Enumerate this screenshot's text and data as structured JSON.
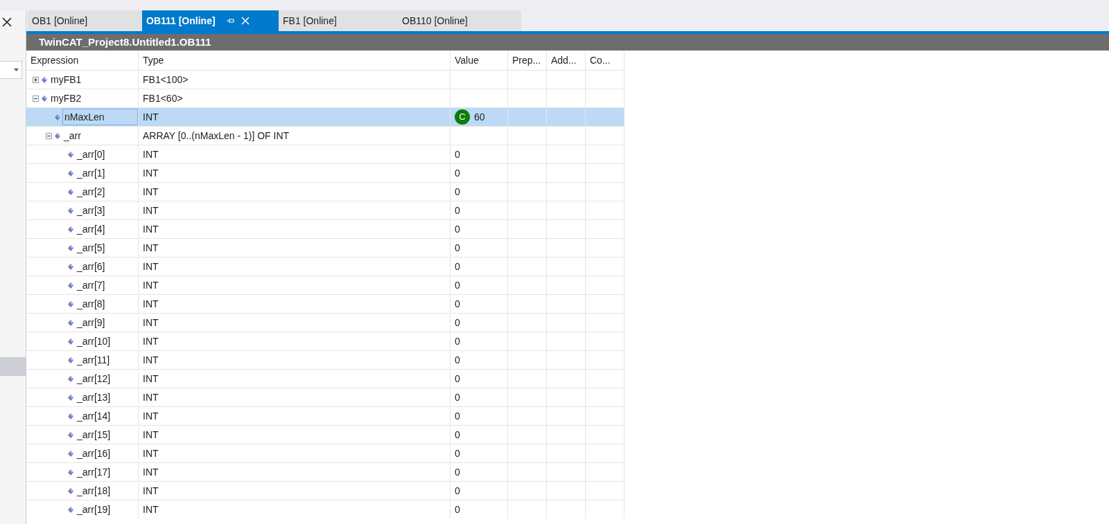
{
  "tabs": [
    {
      "label": "OB1 [Online]",
      "selected": false
    },
    {
      "label": "OB111 [Online]",
      "selected": true
    },
    {
      "label": "FB1 [Online]",
      "selected": false
    },
    {
      "label": "OB110 [Online]",
      "selected": false
    }
  ],
  "editor": {
    "title": "TwinCAT_Project8.Untitled1.OB111"
  },
  "table": {
    "columns": [
      "Expression",
      "Type",
      "Value",
      "Prep...",
      "Add...",
      "Co..."
    ],
    "rows": [
      {
        "expression": "myFB1",
        "type": "FB1<100>",
        "expanded": false,
        "selected": false
      },
      {
        "expression": "myFB2",
        "type": "FB1<60>",
        "expanded": true,
        "selected": false,
        "children": [
          {
            "expression": "nMaxLen",
            "type": "INT",
            "value": "60",
            "badge": "C",
            "selected": true
          },
          {
            "expression": "_arr",
            "type": "ARRAY [0..(nMaxLen - 1)] OF INT",
            "expanded": true,
            "selected": false,
            "children": [
              {
                "expression": "_arr[0]",
                "type": "INT",
                "value": "0",
                "selected": false
              },
              {
                "expression": "_arr[1]",
                "type": "INT",
                "value": "0",
                "selected": false
              },
              {
                "expression": "_arr[2]",
                "type": "INT",
                "value": "0",
                "selected": false
              },
              {
                "expression": "_arr[3]",
                "type": "INT",
                "value": "0",
                "selected": false
              },
              {
                "expression": "_arr[4]",
                "type": "INT",
                "value": "0",
                "selected": false
              },
              {
                "expression": "_arr[5]",
                "type": "INT",
                "value": "0",
                "selected": false
              },
              {
                "expression": "_arr[6]",
                "type": "INT",
                "value": "0",
                "selected": false
              },
              {
                "expression": "_arr[7]",
                "type": "INT",
                "value": "0",
                "selected": false
              },
              {
                "expression": "_arr[8]",
                "type": "INT",
                "value": "0",
                "selected": false
              },
              {
                "expression": "_arr[9]",
                "type": "INT",
                "value": "0",
                "selected": false
              },
              {
                "expression": "_arr[10]",
                "type": "INT",
                "value": "0",
                "selected": false
              },
              {
                "expression": "_arr[11]",
                "type": "INT",
                "value": "0",
                "selected": false
              },
              {
                "expression": "_arr[12]",
                "type": "INT",
                "value": "0",
                "selected": false
              },
              {
                "expression": "_arr[13]",
                "type": "INT",
                "value": "0",
                "selected": false
              },
              {
                "expression": "_arr[14]",
                "type": "INT",
                "value": "0",
                "selected": false
              },
              {
                "expression": "_arr[15]",
                "type": "INT",
                "value": "0",
                "selected": false
              },
              {
                "expression": "_arr[16]",
                "type": "INT",
                "value": "0",
                "selected": false
              },
              {
                "expression": "_arr[17]",
                "type": "INT",
                "value": "0",
                "selected": false
              },
              {
                "expression": "_arr[18]",
                "type": "INT",
                "value": "0",
                "selected": false
              },
              {
                "expression": "_arr[19]",
                "type": "INT",
                "value": "0",
                "selected": false
              }
            ]
          }
        ]
      }
    ]
  }
}
